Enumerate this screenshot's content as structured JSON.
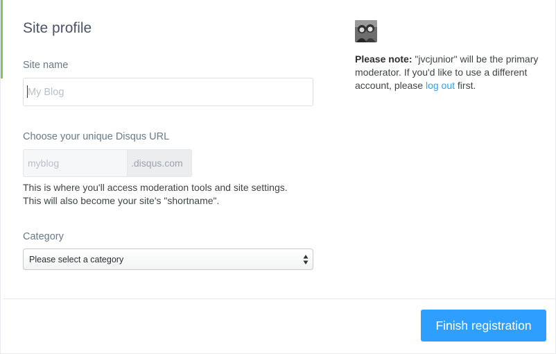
{
  "form": {
    "title": "Site profile",
    "site_name": {
      "label": "Site name",
      "placeholder": "My Blog",
      "value": ""
    },
    "disqus_url": {
      "label": "Choose your unique Disqus URL",
      "placeholder": "myblog",
      "suffix": ".disqus.com",
      "help_line1": "This is where you'll access moderation tools and site settings.",
      "help_line2": "This will also become your site's \"shortname\"."
    },
    "category": {
      "label": "Category",
      "selected": "Please select a category"
    }
  },
  "sidebar": {
    "note_label": "Please note:",
    "note_text": " \"jvcjunior\" will be the primary moderator. If you'd like to use a different account, please ",
    "logout_link": "log out",
    "note_end": " first."
  },
  "footer": {
    "submit_label": "Finish registration"
  },
  "colors": {
    "accent_green": "#7bc855",
    "primary_blue": "#2e9fff",
    "link_blue": "#2e9fff"
  }
}
